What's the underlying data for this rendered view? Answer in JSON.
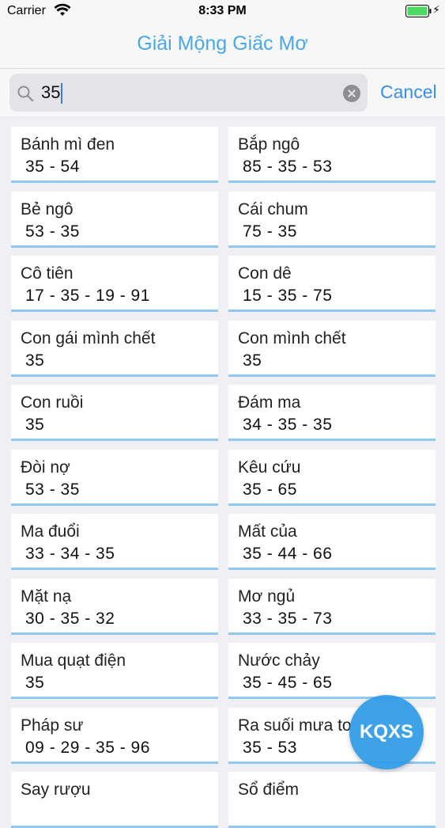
{
  "status": {
    "carrier": "Carrier",
    "time": "8:33 PM"
  },
  "nav": {
    "title": "Giải Mộng Giấc Mơ"
  },
  "search": {
    "value": "35",
    "cancel_label": "Cancel"
  },
  "results": [
    {
      "name": "Bánh mì đen",
      "numbers": "35 - 54"
    },
    {
      "name": "Bắp ngô",
      "numbers": "85 - 35 - 53"
    },
    {
      "name": "Bẻ ngô",
      "numbers": "53 - 35"
    },
    {
      "name": "Cái chum",
      "numbers": "75 - 35"
    },
    {
      "name": "Cô tiên",
      "numbers": "17 - 35 - 19 - 91"
    },
    {
      "name": "Con dê",
      "numbers": "15 - 35 - 75"
    },
    {
      "name": "Con gái mình chết",
      "numbers": "35"
    },
    {
      "name": "Con mình chết",
      "numbers": "35"
    },
    {
      "name": "Con ruồi",
      "numbers": "35"
    },
    {
      "name": "Đám ma",
      "numbers": "34 - 35 - 35"
    },
    {
      "name": "Đòi nợ",
      "numbers": "53 - 35"
    },
    {
      "name": "Kêu cứu",
      "numbers": "35 - 65"
    },
    {
      "name": "Ma đuổi",
      "numbers": "33 - 34 - 35"
    },
    {
      "name": "Mất của",
      "numbers": "35 - 44 - 66"
    },
    {
      "name": "Mặt nạ",
      "numbers": "30 - 35 - 32"
    },
    {
      "name": "Mơ ngủ",
      "numbers": "33 - 35 - 73"
    },
    {
      "name": "Mua quạt điện",
      "numbers": "35"
    },
    {
      "name": "Nước chảy",
      "numbers": "35 - 45 - 65"
    },
    {
      "name": "Pháp sư",
      "numbers": "09 - 29 - 35 - 96"
    },
    {
      "name": "Ra suối mưa to",
      "numbers": "35 - 53"
    },
    {
      "name": "Say rượu",
      "numbers": ""
    },
    {
      "name": "Sổ điểm",
      "numbers": ""
    }
  ],
  "fab": {
    "label": "KQXS"
  },
  "colors": {
    "accent": "#4aa8e8",
    "card_underline": "#8ec9f2",
    "fab": "#2e9be8"
  }
}
